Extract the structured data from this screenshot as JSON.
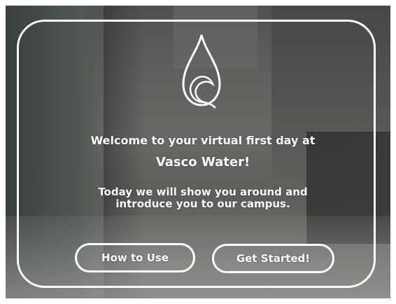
{
  "welcome": {
    "line1": "Welcome to your virtual first day at",
    "company": "Vasco Water!",
    "intro": "Today we will show you around and introduce you to our campus."
  },
  "buttons": {
    "how_to_use": "How to Use",
    "get_started": "Get Started!"
  },
  "colors": {
    "text": "#ffffff",
    "border": "#ffffff"
  },
  "icons": {
    "logo": "water-drop-icon"
  }
}
